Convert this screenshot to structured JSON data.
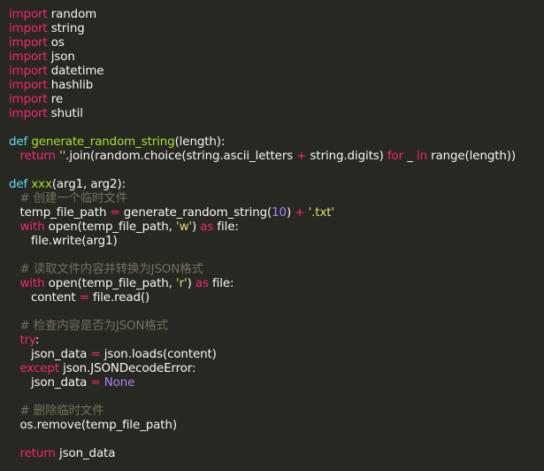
{
  "editor": {
    "theme": "monokai",
    "background": "#272822",
    "colors": {
      "kw": "#f92672",
      "kw2": "#66d9ef",
      "fn": "#a6e22e",
      "num": "#ae81ff",
      "str": "#e6db74",
      "cm": "#75715e",
      "pl": "#f8f8f2",
      "op": "#f92672"
    },
    "lines": [
      [
        [
          "kw",
          "import"
        ],
        [
          "pl",
          " random"
        ]
      ],
      [
        [
          "kw",
          "import"
        ],
        [
          "pl",
          " string"
        ]
      ],
      [
        [
          "kw",
          "import"
        ],
        [
          "pl",
          " os"
        ]
      ],
      [
        [
          "kw",
          "import"
        ],
        [
          "pl",
          " json"
        ]
      ],
      [
        [
          "kw",
          "import"
        ],
        [
          "pl",
          " datetime"
        ]
      ],
      [
        [
          "kw",
          "import"
        ],
        [
          "pl",
          " hashlib"
        ]
      ],
      [
        [
          "kw",
          "import"
        ],
        [
          "pl",
          " re"
        ]
      ],
      [
        [
          "kw",
          "import"
        ],
        [
          "pl",
          " shutil"
        ]
      ],
      [],
      [
        [
          "kw2",
          "def"
        ],
        [
          "pl",
          " "
        ],
        [
          "fn",
          "generate_random_string"
        ],
        [
          "pl",
          "(length):"
        ]
      ],
      [
        [
          "pl",
          "   "
        ],
        [
          "kw",
          "return"
        ],
        [
          "pl",
          " "
        ],
        [
          "str",
          "''"
        ],
        [
          "pl",
          ".join(random.choice(string.ascii_letters "
        ],
        [
          "op",
          "+"
        ],
        [
          "pl",
          " string.digits) "
        ],
        [
          "kw",
          "for"
        ],
        [
          "pl",
          " _ "
        ],
        [
          "kw",
          "in"
        ],
        [
          "pl",
          " range(length))"
        ]
      ],
      [],
      [
        [
          "kw2",
          "def"
        ],
        [
          "pl",
          " "
        ],
        [
          "fn",
          "xxx"
        ],
        [
          "pl",
          "(arg1, arg2):"
        ]
      ],
      [
        [
          "pl",
          "   "
        ],
        [
          "cm",
          "# 创建一个临时文件"
        ]
      ],
      [
        [
          "pl",
          "   temp_file_path "
        ],
        [
          "op",
          "="
        ],
        [
          "pl",
          " generate_random_string("
        ],
        [
          "num",
          "10"
        ],
        [
          "pl",
          ") "
        ],
        [
          "op",
          "+"
        ],
        [
          "pl",
          " "
        ],
        [
          "str",
          "'.txt'"
        ]
      ],
      [
        [
          "pl",
          "   "
        ],
        [
          "kw",
          "with"
        ],
        [
          "pl",
          " open(temp_file_path, "
        ],
        [
          "str",
          "'w'"
        ],
        [
          "pl",
          ") "
        ],
        [
          "kw",
          "as"
        ],
        [
          "pl",
          " file:"
        ]
      ],
      [
        [
          "pl",
          "      file.write(arg1)"
        ]
      ],
      [],
      [
        [
          "pl",
          "   "
        ],
        [
          "cm",
          "# 读取文件内容并转换为JSON格式"
        ]
      ],
      [
        [
          "pl",
          "   "
        ],
        [
          "kw",
          "with"
        ],
        [
          "pl",
          " open(temp_file_path, "
        ],
        [
          "str",
          "'r'"
        ],
        [
          "pl",
          ") "
        ],
        [
          "kw",
          "as"
        ],
        [
          "pl",
          " file:"
        ]
      ],
      [
        [
          "pl",
          "      content "
        ],
        [
          "op",
          "="
        ],
        [
          "pl",
          " file.read()"
        ]
      ],
      [],
      [
        [
          "pl",
          "   "
        ],
        [
          "cm",
          "# 检查内容是否为JSON格式"
        ]
      ],
      [
        [
          "pl",
          "   "
        ],
        [
          "kw",
          "try"
        ],
        [
          "pl",
          ":"
        ]
      ],
      [
        [
          "pl",
          "      json_data "
        ],
        [
          "op",
          "="
        ],
        [
          "pl",
          " json.loads(content)"
        ]
      ],
      [
        [
          "pl",
          "   "
        ],
        [
          "kw",
          "except"
        ],
        [
          "pl",
          " json.JSONDecodeError:"
        ]
      ],
      [
        [
          "pl",
          "      json_data "
        ],
        [
          "op",
          "="
        ],
        [
          "pl",
          " "
        ],
        [
          "num",
          "None"
        ]
      ],
      [],
      [
        [
          "pl",
          "   "
        ],
        [
          "cm",
          "# 删除临时文件"
        ]
      ],
      [
        [
          "pl",
          "   os.remove(temp_file_path)"
        ]
      ],
      [],
      [
        [
          "pl",
          "   "
        ],
        [
          "kw",
          "return"
        ],
        [
          "pl",
          " json_data"
        ]
      ]
    ]
  }
}
